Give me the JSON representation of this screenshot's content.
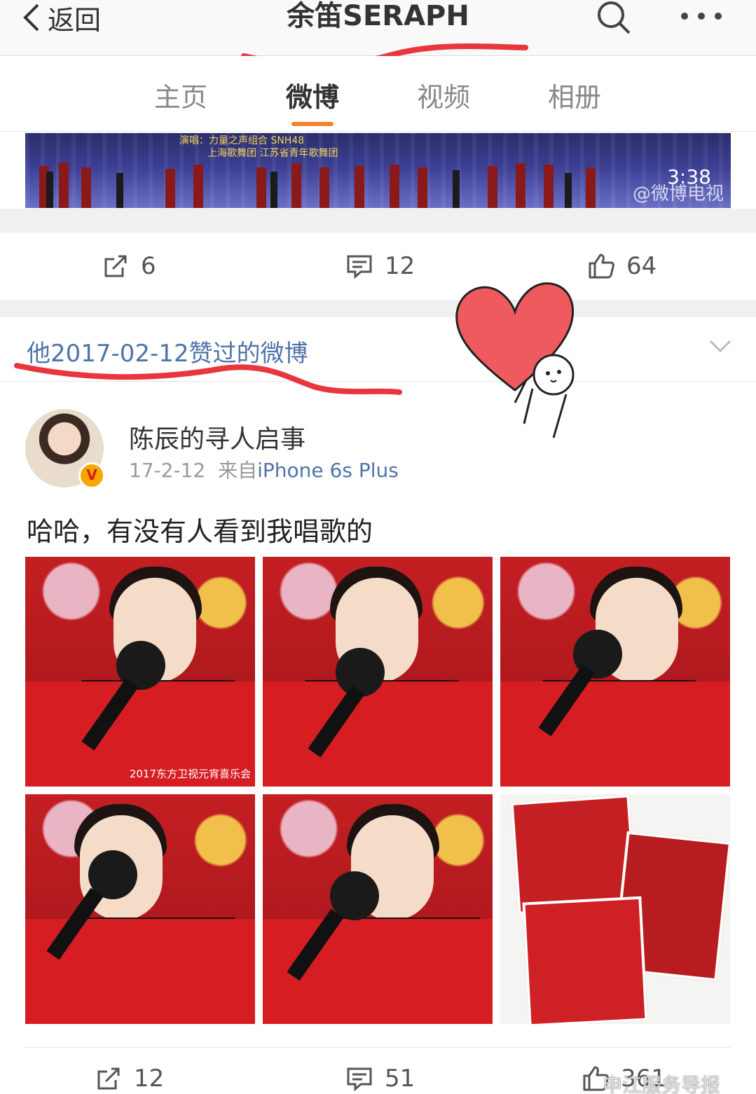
{
  "nav": {
    "back_label": "返回",
    "title": "余笛SERAPH",
    "search_icon": "search-icon",
    "more_icon": "more-icon"
  },
  "tabs": [
    {
      "label": "主页",
      "active": false
    },
    {
      "label": "微博",
      "active": true
    },
    {
      "label": "视频",
      "active": false
    },
    {
      "label": "相册",
      "active": false
    }
  ],
  "video": {
    "caption_line1": "演唱：力量之声组合 SNH48",
    "caption_line2": "上海歌舞团 江苏省青年歌舞团",
    "duration": "3:38",
    "watermark": "@微博电视"
  },
  "post1_actions": {
    "repost": "6",
    "comment": "12",
    "like": "64"
  },
  "liked_header": "他2017-02-12赞过的微博",
  "post": {
    "author": "陈辰的寻人启事",
    "date": "17-2-12",
    "from_label": "来自",
    "source": "iPhone 6s Plus",
    "text": "哈哈，有没有人看到我唱歌的",
    "photo_tags": [
      "2017东方卫视元宵喜乐会",
      "",
      "",
      "",
      "",
      ""
    ]
  },
  "post2_actions": {
    "repost": "12",
    "comment": "51",
    "like": "361"
  },
  "footer_watermark": "申江服务导报",
  "colors": {
    "accent": "#f5822a",
    "link": "#4f73a8",
    "annotation_red": "#e8363d"
  }
}
